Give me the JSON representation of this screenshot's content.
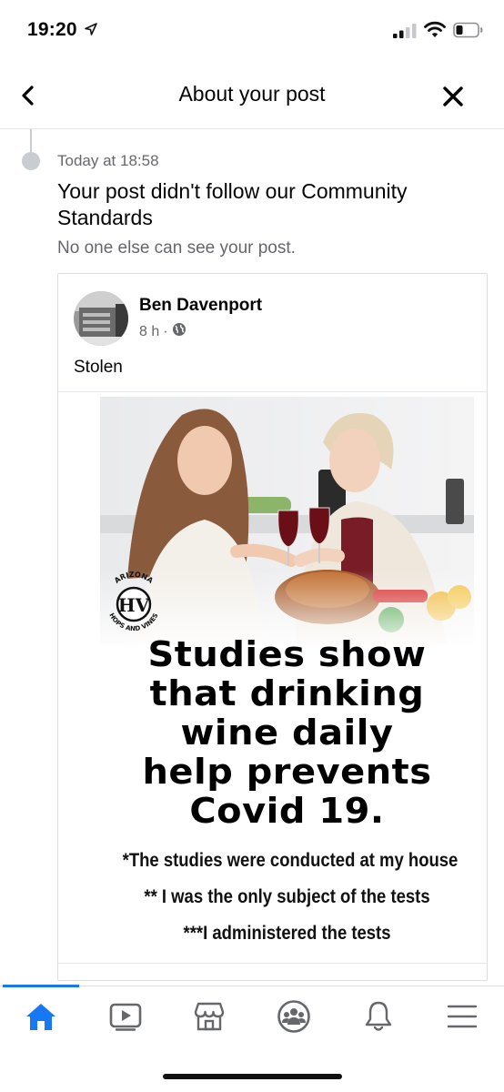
{
  "status_bar": {
    "time": "19:20",
    "icons": [
      "location-arrow-icon",
      "cellular-signal-icon",
      "wifi-icon",
      "battery-icon"
    ]
  },
  "header": {
    "title": "About your post",
    "back_icon": "chevron-left-icon",
    "close_icon": "close-icon"
  },
  "notice": {
    "time": "Today at 18:58",
    "title": "Your post didn't follow our Community Standards",
    "subtitle": "No one else can see your post."
  },
  "post": {
    "author": "Ben Davenport",
    "age": "8 h",
    "meta_separator": "·",
    "privacy_icon": "globe-icon",
    "text": "Stolen",
    "image": {
      "logo_text_top": "ARIZONA",
      "logo_letters": "HV",
      "logo_text_bottom": "HOPS AND VINES",
      "caption_lines": [
        "Studies show",
        "that drinking",
        "wine daily",
        "help prevents",
        "Covid 19."
      ],
      "footnotes": [
        "*The studies were conducted at my house",
        "** I was the only subject of the tests",
        "***I administered the tests"
      ]
    }
  },
  "bottom_nav": {
    "items": [
      {
        "name": "home",
        "icon": "home-icon",
        "active": true
      },
      {
        "name": "watch",
        "icon": "video-icon",
        "active": false
      },
      {
        "name": "marketplace",
        "icon": "shop-icon",
        "active": false
      },
      {
        "name": "groups",
        "icon": "groups-icon",
        "active": false
      },
      {
        "name": "notifications",
        "icon": "bell-icon",
        "active": false
      },
      {
        "name": "menu",
        "icon": "menu-icon",
        "active": false
      }
    ]
  },
  "colors": {
    "accent": "#1877f2",
    "text_primary": "#050505",
    "text_secondary": "#65676b",
    "divider": "#dadde1"
  }
}
